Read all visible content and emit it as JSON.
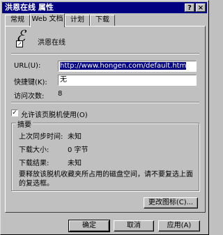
{
  "window": {
    "title": "洪恩在线 属性",
    "help_button": "?",
    "close_button": "×"
  },
  "tabs": [
    {
      "label": "常规"
    },
    {
      "label": "Web 文档"
    },
    {
      "label": "计划"
    },
    {
      "label": "下载"
    }
  ],
  "page": {
    "site_name": "洪恩在线",
    "url_label": "URL(U):",
    "url_value": "http://www.hongen.com/default.htm",
    "shortcut_label": "快捷键(K):",
    "shortcut_value": "无",
    "visits_label": "访问次数:",
    "visits_value": "8",
    "offline_checkbox_label": "允许该页脱机使用(O)",
    "offline_checked": true,
    "summary": {
      "legend": "摘要",
      "last_sync_label": "上次同步时间:",
      "last_sync_value": "未知",
      "download_size_label": "下载大小:",
      "download_size_value": "0 字节",
      "download_result_label": "下载结果:",
      "download_result_value": "未知",
      "note": "要释放该脱机收藏夹所占用的磁盘空间，请不要复选上面的复选框。"
    },
    "change_icon_button": "更改图标(C)..."
  },
  "footer": {
    "ok": "确定",
    "cancel": "取消",
    "apply": "应用(A)"
  }
}
